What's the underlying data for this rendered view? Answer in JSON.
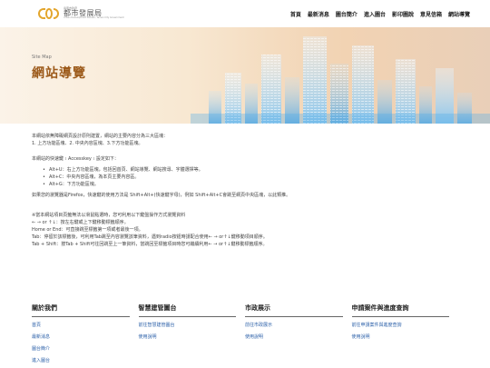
{
  "header": {
    "logo_sub": "臺南市政府",
    "logo_main": "都市發展局",
    "logo_en": "Urban Development Bureau, Tainan City Government",
    "nav": [
      "首頁",
      "最新消息",
      "圖台簡介",
      "進入圖台",
      "影印圖說",
      "意見信箱",
      "網站導覽"
    ]
  },
  "banner": {
    "title_en": "Site Map",
    "title": "網站導覽"
  },
  "content": {
    "p1": "本網站依無障礙網頁設計原則建置，網站的主要內容分為三大區塊：",
    "p2": "1. 上方功能區塊、2. 中央內容區塊、3.下方功能區塊。",
    "p3": "本網站的快速鍵﹝Accesskey﹞設定如下：",
    "keys": [
      "Alt+U：右上方功能區塊，包括回首頁、網站導覽、網站搜尋、字體選擇等。",
      "Alt+C：中央內容區塊，為本頁主要內容區。",
      "Alt+G：下方功能區塊。"
    ],
    "p4": "如果您的瀏覽器是Firefox，快速鍵的使用方法是 Shift+Alt+(快速鍵字母)，例如 Shift+Alt+C會跳至網頁中央區塊，以此類推。",
    "p5": "※當本網站項目頁籤無法以滑鼠點選時，您可利用以下鍵盤操作方式瀏覽資料",
    "p6": "← → or ↑↓：按左右鍵或上下鍵移動標籤順序。",
    "p7": "Home or End：可直接跳至標籤第一項或者最後一項。",
    "p8": "Tab：停留於該標籤後，可利用Tab跳至內容瀏覽該筆資料，遇到radio按鈕時請配合使用← → or↑↓鍵移動項目順序。",
    "p9": "Tab + Shift：按Tab + Shift可往回跳至上一筆資料，當跳回至標籤項目時您可繼續利用← → or↑↓鍵移動標籤順序。"
  },
  "footer": {
    "columns": [
      {
        "title": "關於我們",
        "links": [
          "首頁",
          "最新消息",
          "圖台簡介",
          "進入圖台"
        ]
      },
      {
        "title": "智慧建管圖台",
        "links": [
          "前往智慧建管圖台",
          "使用說明"
        ]
      },
      {
        "title": "市政展示",
        "links": [
          "前往市政展示",
          "使用說明"
        ]
      },
      {
        "title": "申請案件與進度查詢",
        "links": [
          "前往申請案件與進度查詢",
          "使用說明"
        ]
      }
    ]
  },
  "colors": {
    "accent": "#9c5a1a",
    "logo": "#e3a52c",
    "link": "#2a5fa8",
    "city_blue": "#4aa3e0"
  }
}
